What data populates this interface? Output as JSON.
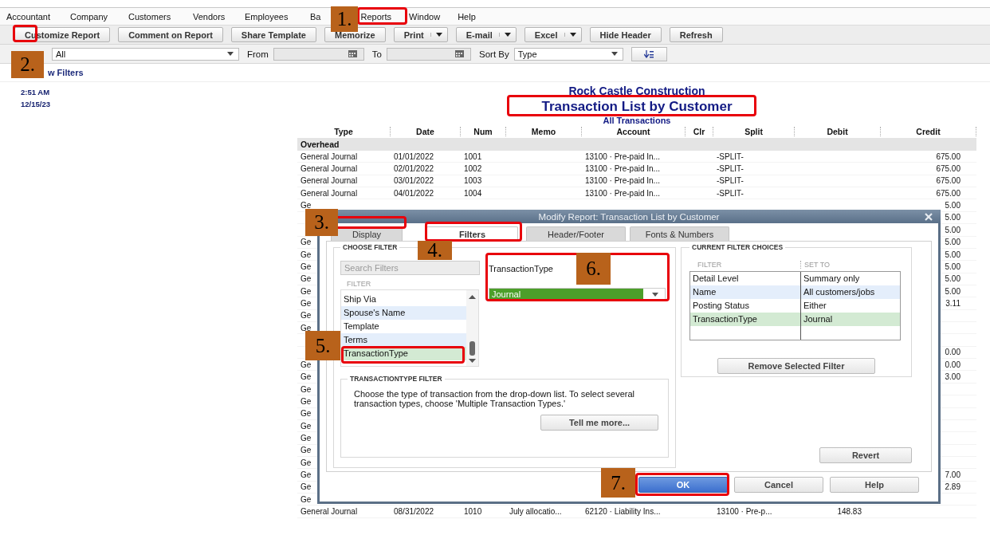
{
  "menu": [
    "Accountant",
    "Company",
    "Customers",
    "Vendors",
    "Employees",
    "Ba",
    "Reports",
    "Window",
    "Help"
  ],
  "toolbar": [
    {
      "label": "Customize Report",
      "kind": "button"
    },
    {
      "label": "Comment on Report",
      "kind": "button"
    },
    {
      "label": "Share Template",
      "kind": "button"
    },
    {
      "label": "Memorize",
      "kind": "button"
    },
    {
      "label": "Print",
      "kind": "split"
    },
    {
      "label": "E-mail",
      "kind": "split"
    },
    {
      "label": "Excel",
      "kind": "split"
    },
    {
      "label": "Hide Header",
      "kind": "button"
    },
    {
      "label": "Refresh",
      "kind": "button"
    }
  ],
  "filter_bar": {
    "dates_value": "All",
    "from_label": "From",
    "to_label": "To",
    "sort_label": "Sort By",
    "sort_value": "Type"
  },
  "show_filters": "w Filters",
  "report_time": "2:51 AM",
  "report_date": "12/15/23",
  "report": {
    "company": "Rock Castle Construction",
    "title": "Transaction List by Customer",
    "subtitle": "All Transactions",
    "columns": [
      "Type",
      "Date",
      "Num",
      "Memo",
      "Account",
      "Clr",
      "Split",
      "Debit",
      "Credit"
    ],
    "group": "Overhead",
    "rows": [
      {
        "type": "General Journal",
        "date": "01/01/2022",
        "num": "1001",
        "account": "13100 · Pre-paid In...",
        "split": "-SPLIT-",
        "credit": "675.00"
      },
      {
        "type": "General Journal",
        "date": "02/01/2022",
        "num": "1002",
        "account": "13100 · Pre-paid In...",
        "split": "-SPLIT-",
        "credit": "675.00"
      },
      {
        "type": "General Journal",
        "date": "03/01/2022",
        "num": "1003",
        "account": "13100 · Pre-paid In...",
        "split": "-SPLIT-",
        "credit": "675.00"
      },
      {
        "type": "General Journal",
        "date": "04/01/2022",
        "num": "1004",
        "account": "13100 · Pre-paid In...",
        "split": "-SPLIT-",
        "credit": "675.00"
      },
      {
        "type": "Ge",
        "credit": "5.00"
      },
      {
        "credit": "5.00"
      },
      {
        "credit": "5.00"
      },
      {
        "type": "Ge",
        "credit": "5.00"
      },
      {
        "type": "Ge",
        "credit": "5.00"
      },
      {
        "type": "Ge",
        "credit": "5.00"
      },
      {
        "type": "Ge",
        "credit": "5.00"
      },
      {
        "type": "Ge",
        "credit": "5.00"
      },
      {
        "type": "Ge",
        "credit": "3.11"
      },
      {
        "type": "Ge"
      },
      {
        "type": "Ge"
      },
      {},
      {
        "credit": "0.00"
      },
      {
        "type": "Ge",
        "credit": "0.00"
      },
      {
        "type": "Ge",
        "credit": "3.00"
      },
      {
        "type": "Ge"
      },
      {
        "type": "Ge"
      },
      {
        "type": "Ge"
      },
      {
        "type": "Ge"
      },
      {
        "type": "Ge"
      },
      {
        "type": "Ge"
      },
      {
        "type": "Ge"
      },
      {
        "type": "Ge",
        "credit": "7.00"
      },
      {
        "type": "Ge",
        "credit": "2.89"
      },
      {
        "type": "Ge"
      },
      {
        "type": "General Journal",
        "date": "08/31/2022",
        "num": "1010",
        "memo": "July allocatio...",
        "account": "62120 · Liability Ins...",
        "split": "13100 · Pre-p...",
        "debit": "148.83"
      }
    ]
  },
  "dialog": {
    "title": "Modify Report: Transaction List by Customer",
    "tabs": [
      {
        "label": "Display",
        "selected": false
      },
      {
        "label": "Filters",
        "selected": true
      },
      {
        "label": "Header/Footer",
        "selected": false
      },
      {
        "label": "Fonts & Numbers",
        "selected": false
      }
    ],
    "choose_filter": {
      "heading": "CHOOSE FILTER",
      "search_placeholder": "Search Filters",
      "list_heading": "FILTER",
      "items": [
        {
          "label": "Ship Via",
          "selected": false
        },
        {
          "label": "Spouse's Name",
          "selected": false
        },
        {
          "label": "Template",
          "selected": false
        },
        {
          "label": "Terms",
          "selected": false
        },
        {
          "label": "TransactionType",
          "selected": true
        }
      ]
    },
    "filter_field": {
      "label": "TransactionType",
      "value": "Journal"
    },
    "help": {
      "heading": "TRANSACTIONTYPE FILTER",
      "text": "Choose the type of transaction from the drop-down list. To select several transaction types, choose 'Multiple Transaction Types.'",
      "button": "Tell me more..."
    },
    "current": {
      "heading": "CURRENT FILTER CHOICES",
      "columns": [
        "FILTER",
        "SET TO"
      ],
      "rows": [
        {
          "filter": "Detail Level",
          "set_to": "Summary only",
          "selected": false
        },
        {
          "filter": "Name",
          "set_to": "All customers/jobs",
          "selected": false
        },
        {
          "filter": "Posting Status",
          "set_to": "Either",
          "selected": false
        },
        {
          "filter": "TransactionType",
          "set_to": "Journal",
          "selected": true
        }
      ],
      "remove_button": "Remove Selected Filter"
    },
    "revert_button": "Revert",
    "buttons": [
      {
        "label": "OK",
        "kind": "primary"
      },
      {
        "label": "Cancel",
        "kind": "normal"
      },
      {
        "label": "Help",
        "kind": "normal"
      }
    ]
  },
  "annotations": [
    "1.",
    "2.",
    "3.",
    "4.",
    "5.",
    "6.",
    "7."
  ]
}
